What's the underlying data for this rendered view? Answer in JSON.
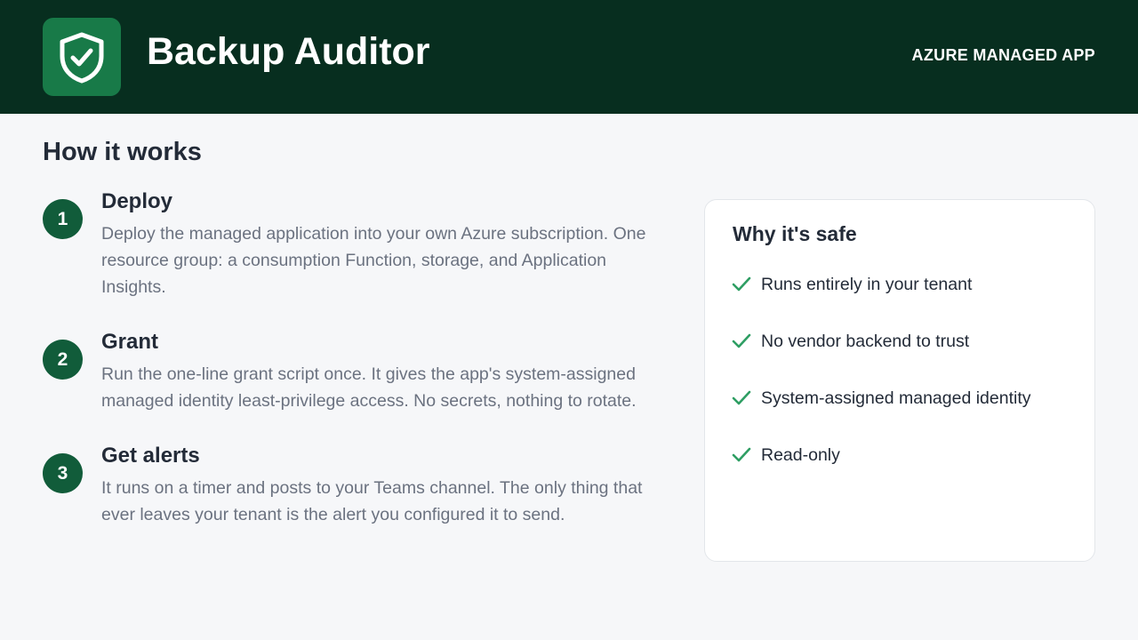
{
  "header": {
    "app_title": "Backup Auditor",
    "badge": "AZURE MANAGED APP",
    "logo_icon": "shield-check-icon"
  },
  "how_it_works": {
    "title": "How it works",
    "steps": [
      {
        "number": "1",
        "title": "Deploy",
        "description": "Deploy the managed application into your own Azure subscription. One resource group: a consumption Function, storage, and Application Insights."
      },
      {
        "number": "2",
        "title": "Grant",
        "description": "Run the one-line grant script once. It gives the app's system-assigned managed identity least-privilege access. No secrets, nothing to rotate."
      },
      {
        "number": "3",
        "title": "Get alerts",
        "description": "It runs on a timer and posts to your Teams channel. The only thing that ever leaves your tenant is the alert you configured it to send."
      }
    ]
  },
  "safety_card": {
    "title": "Why it's safe",
    "items": [
      "Runs entirely in your tenant",
      "No vendor backend to trust",
      "System-assigned managed identity",
      "Read-only"
    ]
  },
  "colors": {
    "header_bg": "#072e1f",
    "logo_bg": "#187a48",
    "step_circle": "#115c3a",
    "check": "#2e9e63",
    "body_bg": "#f6f7f9"
  }
}
